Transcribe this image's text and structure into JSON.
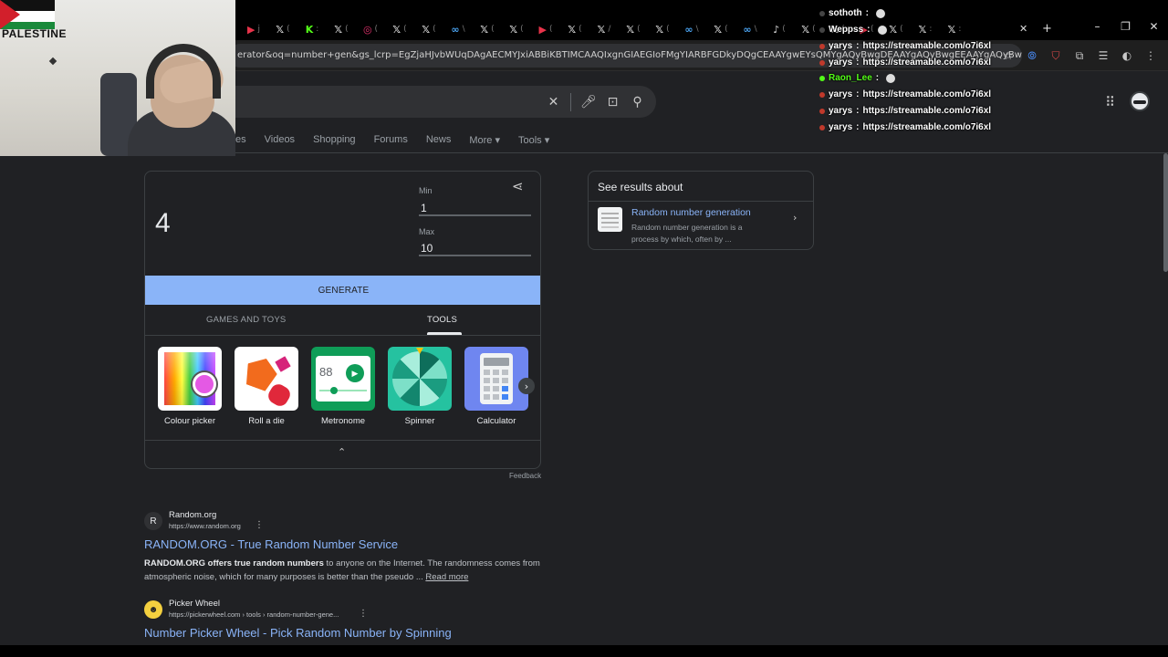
{
  "browser": {
    "tabs": [
      {
        "icon": "youtube-icon",
        "glyph": "▶",
        "color": "#e8334a",
        "text": "j"
      },
      {
        "icon": "x-icon",
        "glyph": "𝕏",
        "color": "#ddd",
        "text": "("
      },
      {
        "icon": "kick-icon",
        "glyph": "K",
        "color": "#53fc18",
        "text": ":"
      },
      {
        "icon": "x-icon",
        "glyph": "𝕏",
        "color": "#ddd",
        "text": "("
      },
      {
        "icon": "instagram-icon",
        "glyph": "◎",
        "color": "#e1306c",
        "text": "("
      },
      {
        "icon": "x-icon",
        "glyph": "𝕏",
        "color": "#ddd",
        "text": "("
      },
      {
        "icon": "x-icon",
        "glyph": "𝕏",
        "color": "#ddd",
        "text": "("
      },
      {
        "icon": "app-icon",
        "glyph": "∞",
        "color": "#4aa3f0",
        "text": "\\"
      },
      {
        "icon": "x-icon",
        "glyph": "𝕏",
        "color": "#ddd",
        "text": "("
      },
      {
        "icon": "x-icon",
        "glyph": "𝕏",
        "color": "#ddd",
        "text": "("
      },
      {
        "icon": "youtube-icon",
        "glyph": "▶",
        "color": "#e8334a",
        "text": "("
      },
      {
        "icon": "x-icon",
        "glyph": "𝕏",
        "color": "#ddd",
        "text": "("
      },
      {
        "icon": "x-icon",
        "glyph": "𝕏",
        "color": "#ddd",
        "text": "/"
      },
      {
        "icon": "x-icon",
        "glyph": "𝕏",
        "color": "#ddd",
        "text": "("
      },
      {
        "icon": "x-icon",
        "glyph": "𝕏",
        "color": "#ddd",
        "text": "("
      },
      {
        "icon": "app-icon",
        "glyph": "∞",
        "color": "#4aa3f0",
        "text": "\\"
      },
      {
        "icon": "x-icon",
        "glyph": "𝕏",
        "color": "#ddd",
        "text": "("
      },
      {
        "icon": "app-icon",
        "glyph": "∞",
        "color": "#4aa3f0",
        "text": "\\"
      },
      {
        "icon": "tiktok-icon",
        "glyph": "♪",
        "color": "#ddd",
        "text": "("
      },
      {
        "icon": "x-icon",
        "glyph": "𝕏",
        "color": "#ddd",
        "text": "("
      },
      {
        "icon": "x-icon",
        "glyph": "𝕏",
        "color": "#ddd",
        "text": "("
      },
      {
        "icon": "youtube-icon",
        "glyph": "▶",
        "color": "#e8334a",
        "text": "("
      },
      {
        "icon": "x-icon",
        "glyph": "𝕏",
        "color": "#ddd",
        "text": "("
      },
      {
        "icon": "x-icon",
        "glyph": "𝕏",
        "color": "#ddd",
        "text": ":"
      },
      {
        "icon": "x-icon",
        "glyph": "𝕏",
        "color": "#ddd",
        "text": ":"
      }
    ],
    "url": "erator&oq=number+gen&gs_lcrp=EgZjaHJvbWUqDAgAECMYJxiABBiKBTIMCAAQIxgnGIAEGIoFMgYIARBFGDkyDQgCEAAYgwEYsQMYgAQyBwgDEAAYgAQyBwgEEAAYgAQyBwgFEAAYgAQyBwgGEAAYgAQy"
  },
  "webcam": {
    "flag_text": "PALESTINE"
  },
  "chat": [
    {
      "user": "sothoth",
      "color": "#ffffff",
      "dot": "#444",
      "msg": "",
      "emote": "skull-emote"
    },
    {
      "user": "Weppss",
      "color": "#ffffff",
      "dot": "#444",
      "msg": "",
      "emote": "emotes"
    },
    {
      "user": "yarys",
      "color": "#ffffff",
      "dot": "#c0392b",
      "msg": "https://streamable.com/o7i6xl"
    },
    {
      "user": "yarys",
      "color": "#ffffff",
      "dot": "#c0392b",
      "msg": "https://streamable.com/o7i6xl"
    },
    {
      "user": "Raon_Lee",
      "color": "#53fc18",
      "dot": "#53fc18",
      "msg": "",
      "emote": "skull-emote"
    },
    {
      "user": "yarys",
      "color": "#ffffff",
      "dot": "#c0392b",
      "msg": "https://streamable.com/o7i6xl"
    },
    {
      "user": "yarys",
      "color": "#ffffff",
      "dot": "#c0392b",
      "msg": "https://streamable.com/o7i6xl"
    },
    {
      "user": "yarys",
      "color": "#ffffff",
      "dot": "#c0392b",
      "msg": "https://streamable.com/o7i6xl"
    }
  ],
  "nav_tabs": [
    "es",
    "Videos",
    "Shopping",
    "Forums",
    "News",
    "More ▾",
    "Tools ▾"
  ],
  "rng": {
    "result": "4",
    "min_label": "Min",
    "min_value": "1",
    "max_label": "Max",
    "max_value": "10",
    "generate": "GENERATE",
    "tab_games": "GAMES AND TOYS",
    "tab_tools": "TOOLS",
    "tools": [
      "Colour picker",
      "Roll a die",
      "Metronome",
      "Spinner",
      "Calculator"
    ],
    "metronome_value": "88",
    "feedback": "Feedback"
  },
  "about": {
    "title": "See results about",
    "link": "Random number generation",
    "desc": "Random number generation is a process by which, often by ..."
  },
  "results": [
    {
      "fav": "R",
      "site": "Random.org",
      "url": "https://www.random.org",
      "title": "RANDOM.ORG - True Random Number Service",
      "snippet_bold": "RANDOM.ORG offers true random numbers",
      "snippet_rest": " to anyone on the Internet. The randomness comes from atmospheric noise, which for many purposes is better than the pseudo ...",
      "read_more": "Read more"
    },
    {
      "fav": "☻",
      "site": "Picker Wheel",
      "url": "https://pickerwheel.com › tools › random-number-gene...",
      "title": "Number Picker Wheel - Pick Random Number by Spinning"
    }
  ]
}
